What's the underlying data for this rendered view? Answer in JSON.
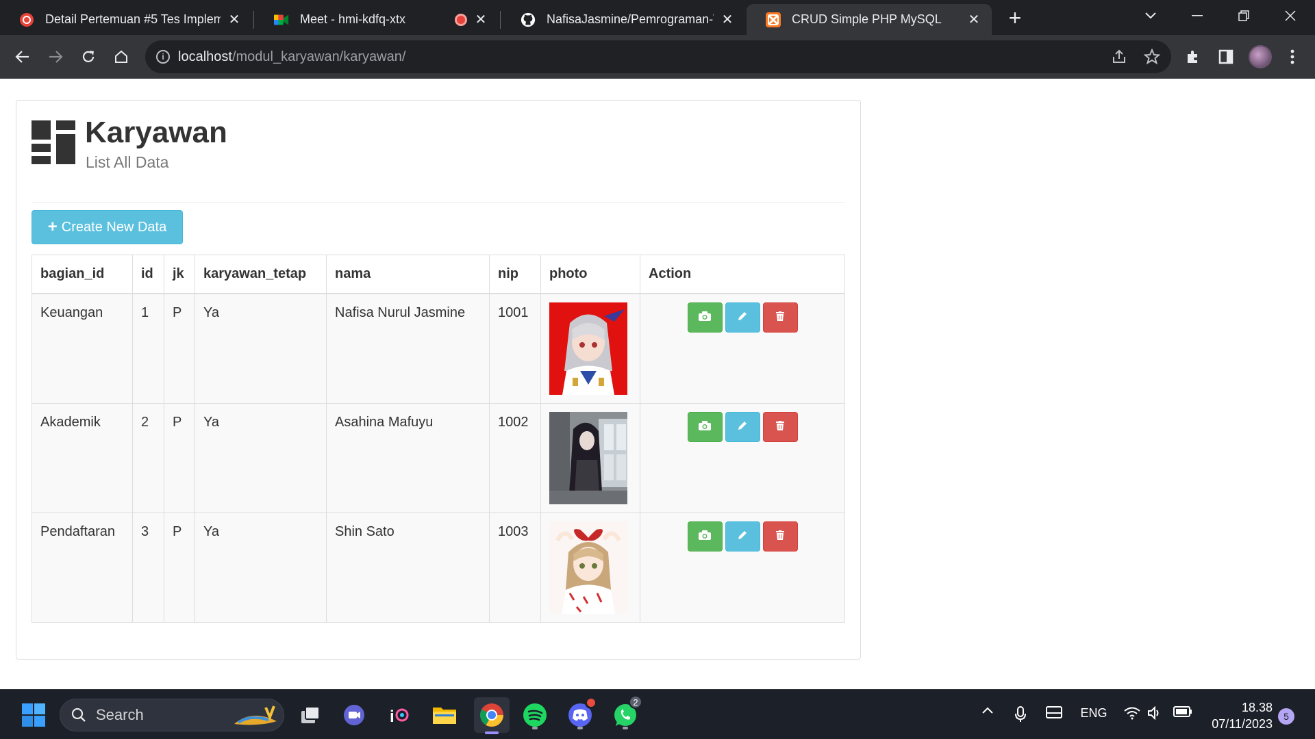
{
  "browser": {
    "tabs": [
      {
        "title": "Detail Pertemuan #5 Tes Implem",
        "favicon": "record-icon",
        "color": "#e8423b"
      },
      {
        "title": "Meet - hmi-kdfq-xtx",
        "favicon": "google-meet-icon",
        "color": "#00897b"
      },
      {
        "title": "NafisaJasmine/Pemrograman-W",
        "favicon": "github-icon",
        "color": "#ffffff"
      },
      {
        "title": "CRUD Simple PHP MySQL",
        "favicon": "xampp-icon",
        "color": "#fb7a24"
      }
    ],
    "url_host": "localhost",
    "url_path": "/modul_karyawan/karyawan/"
  },
  "page": {
    "title": "Karyawan",
    "subtitle": "List All Data",
    "create_button": "Create New Data",
    "columns": [
      "bagian_id",
      "id",
      "jk",
      "karyawan_tetap",
      "nama",
      "nip",
      "photo",
      "Action"
    ],
    "rows": [
      {
        "bagian_id": "Keuangan",
        "id": "1",
        "jk": "P",
        "karyawan_tetap": "Ya",
        "nama": "Nafisa Nurul Jasmine",
        "nip": "1001"
      },
      {
        "bagian_id": "Akademik",
        "id": "2",
        "jk": "P",
        "karyawan_tetap": "Ya",
        "nama": "Asahina Mafuyu",
        "nip": "1002"
      },
      {
        "bagian_id": "Pendaftaran",
        "id": "3",
        "jk": "P",
        "karyawan_tetap": "Ya",
        "nama": "Shin Sato",
        "nip": "1003"
      }
    ],
    "colors": {
      "info": "#5bc0de",
      "success": "#5cb85c",
      "danger": "#d9534f"
    }
  },
  "taskbar": {
    "search_label": "Search",
    "language": "ENG",
    "time": "18.38",
    "date": "07/11/2023",
    "notification_count": "5",
    "discord_badge": "",
    "whatsapp_badge": "2"
  }
}
